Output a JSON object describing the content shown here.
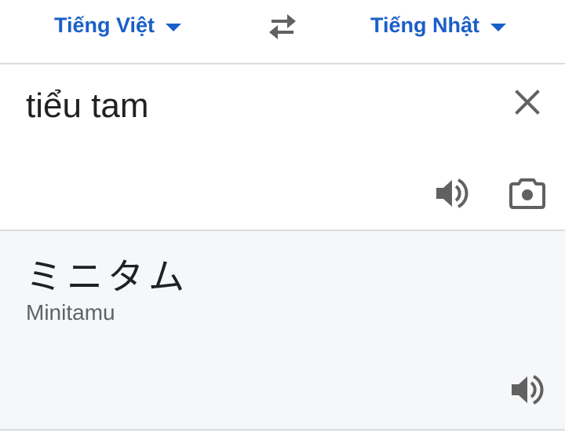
{
  "language_bar": {
    "source_language": "Tiếng Việt",
    "target_language": "Tiếng Nhật",
    "swap_icon": "swap-arrows-icon",
    "dropdown_icon": "caret-down-icon"
  },
  "source": {
    "text": "tiểu tam",
    "clear_icon": "close-icon",
    "speaker_icon": "speaker-icon",
    "camera_icon": "camera-icon"
  },
  "result": {
    "text": "ミニタム",
    "romanization": "Minitamu",
    "speaker_icon": "speaker-icon"
  },
  "colors": {
    "accent": "#1a5fc8",
    "text_primary": "#202124",
    "text_secondary": "#5f6368",
    "icon": "#616161",
    "divider": "#dadce0",
    "result_background": "#f6f7f9"
  }
}
